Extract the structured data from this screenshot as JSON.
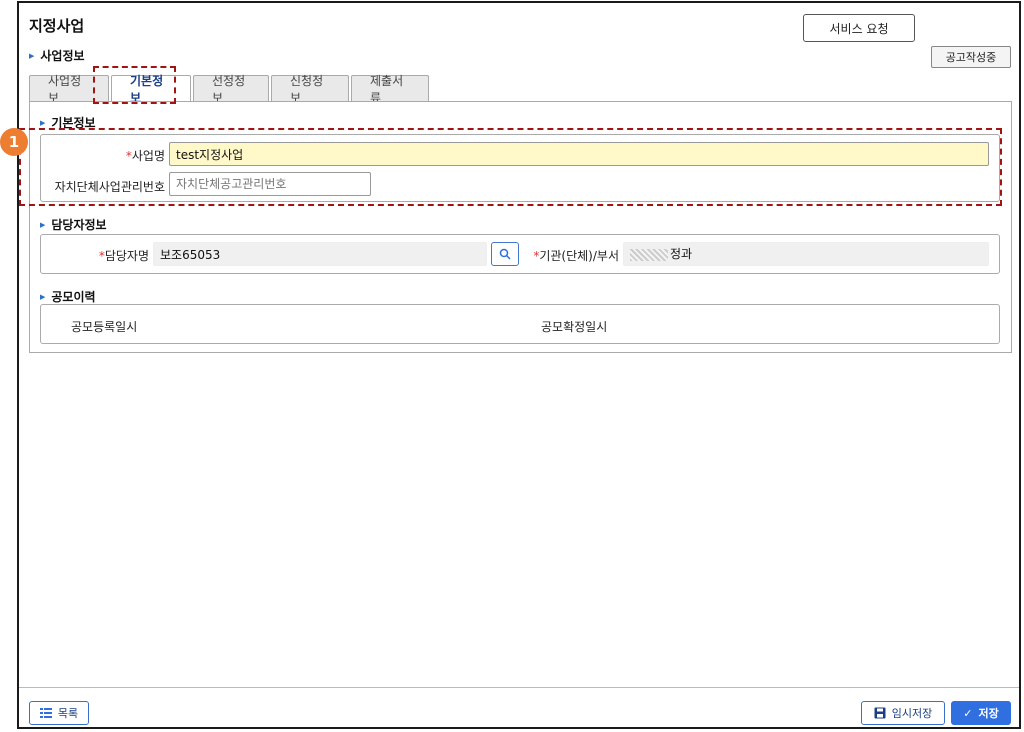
{
  "header": {
    "title": "지정사업",
    "service_request": "서비스 요청",
    "status": "공고작성중"
  },
  "section_business": "사업정보",
  "tabs": [
    {
      "label": "사업정보"
    },
    {
      "label": "기본정보"
    },
    {
      "label": "선정정보"
    },
    {
      "label": "신청정보"
    },
    {
      "label": "제출서류"
    }
  ],
  "basic": {
    "title": "기본정보",
    "step": "1",
    "name_label": "사업명",
    "name_value": "test지정사업",
    "mgmt_label": "자치단체사업관리번호",
    "mgmt_placeholder": "자치단체공고관리번호"
  },
  "manager": {
    "title": "담당자정보",
    "name_label": "담당자명",
    "name_value": "보조65053",
    "org_label": "기관(단체)/부서",
    "org_value": "정과"
  },
  "history": {
    "title": "공모이력",
    "reg_label": "공모등록일시",
    "confirm_label": "공모확정일시"
  },
  "footer": {
    "list": "목록",
    "temp_save": "임시저장",
    "save": "저장"
  },
  "colors": {
    "accent": "#2f6fe0",
    "marker": "#a01414",
    "badge": "#ed7d31",
    "required": "#dd3333",
    "highlight_input": "#fff8c8"
  }
}
